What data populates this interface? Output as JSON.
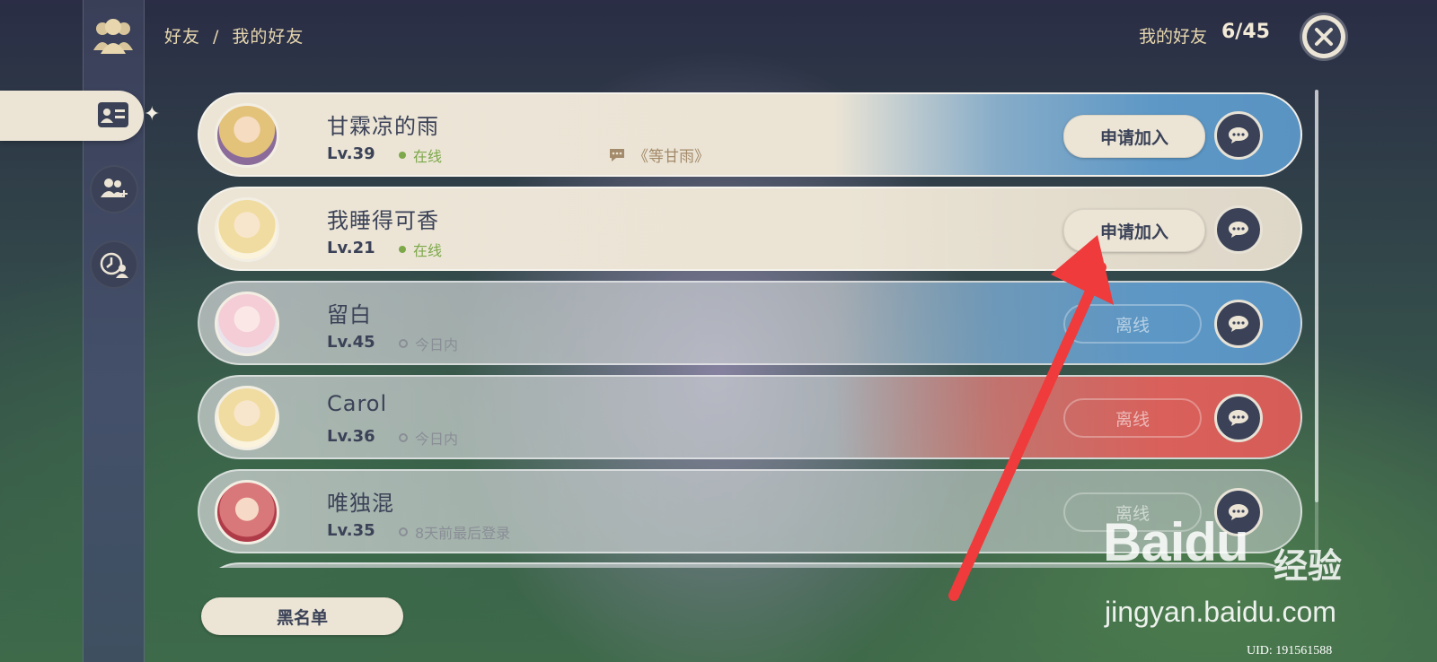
{
  "header": {
    "breadcrumb_root": "好友",
    "breadcrumb_sep": "/",
    "breadcrumb_current": "我的好友",
    "count_label": "我的好友",
    "count_value": "6/45"
  },
  "sidebar": {
    "items": [
      {
        "name": "friends-list",
        "icon": "id-card-icon",
        "active": true
      },
      {
        "name": "add-friend",
        "icon": "add-user-icon",
        "active": false
      },
      {
        "name": "recent",
        "icon": "clock-user-icon",
        "active": false
      }
    ]
  },
  "friends": [
    {
      "name": "甘霖凉的雨",
      "level": "Lv.39",
      "status": "在线",
      "online": true,
      "signature": "《等甘雨》",
      "action": "申请加入",
      "art": "blue"
    },
    {
      "name": "我睡得可香",
      "level": "Lv.21",
      "status": "在线",
      "online": true,
      "signature": "",
      "action": "申请加入",
      "art": "soft"
    },
    {
      "name": "留白",
      "level": "Lv.45",
      "status": "今日内",
      "online": false,
      "signature": "",
      "action": "离线",
      "art": "blue"
    },
    {
      "name": "Carol",
      "level": "Lv.36",
      "status": "今日内",
      "online": false,
      "signature": "",
      "action": "离线",
      "art": "red"
    },
    {
      "name": "唯独混",
      "level": "Lv.35",
      "status": "8天前最后登录",
      "online": false,
      "signature": "",
      "action": "离线",
      "art": "none"
    }
  ],
  "footer": {
    "blacklist_label": "黑名单",
    "uid": "UID: 191561588"
  },
  "watermark": {
    "logo": "Bai",
    "logo_suffix": "du",
    "cn": "经验",
    "url": "jingyan.baidu.com"
  },
  "colors": {
    "accent_dark": "#3b4257",
    "card_light": "#ece5d6",
    "online_green": "#7ca84a",
    "annotation_red": "#ef3b3b"
  }
}
